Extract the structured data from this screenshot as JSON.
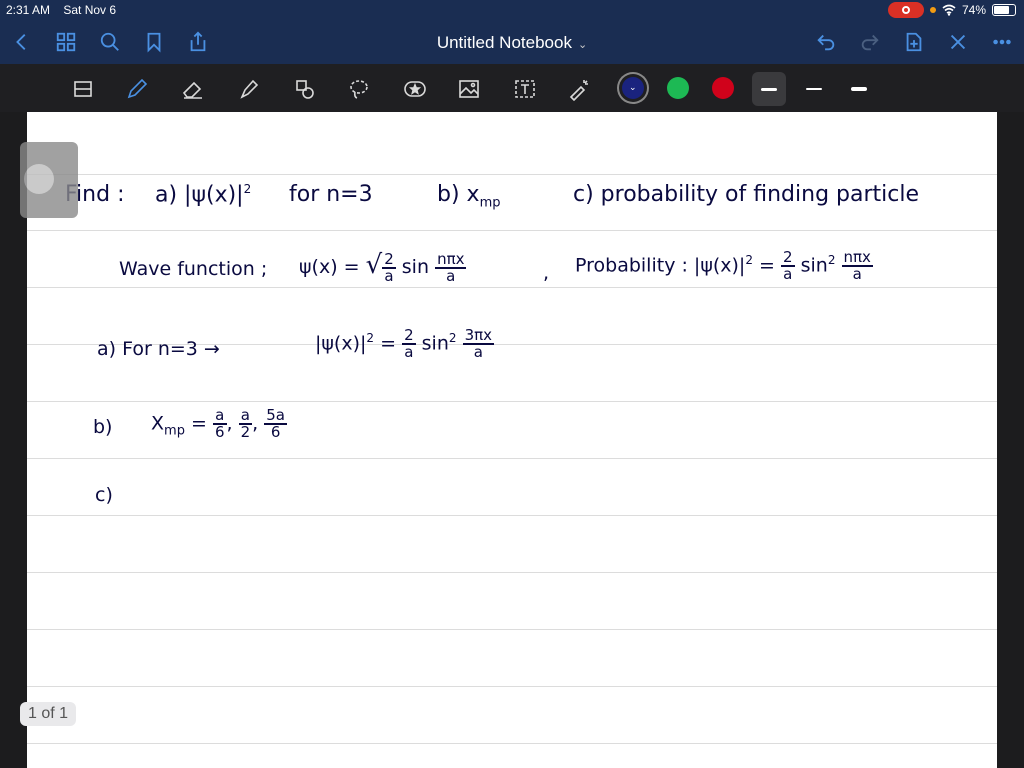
{
  "status": {
    "time": "2:31 AM",
    "date": "Sat Nov 6",
    "battery": "74%",
    "battery_level": 0.74
  },
  "nav": {
    "title": "Untitled Notebook"
  },
  "toolbar": {
    "colors": [
      "#1a237e",
      "#1db954",
      "#d0021b"
    ],
    "tools": [
      "scan-icon",
      "pen-icon",
      "eraser-icon",
      "highlighter-icon",
      "shapes-icon",
      "lasso-icon",
      "star-icon",
      "image-icon",
      "text-icon",
      "laser-icon"
    ]
  },
  "notes": {
    "line1": {
      "find": "Find :",
      "a": "a) |ψ(x)|",
      "a_sup": "2",
      "a_cond": "for n=3",
      "b": "b) x",
      "b_sub": "mp",
      "c": "c) probability of finding particle"
    },
    "line2": {
      "wf": "Wave function ;",
      "psi": "ψ(x) =",
      "root": "√",
      "frac1_num": "2",
      "frac1_den": "a",
      "sin": "sin",
      "frac2_num": "nπx",
      "frac2_den": "a",
      "comma": ",",
      "prob": "Probability : |ψ(x)|",
      "prob_sup": "2",
      "eq": "=",
      "frac3_num": "2",
      "frac3_den": "a",
      "sin2": "sin",
      "sin2_sup": "2",
      "frac4_num": "nπx",
      "frac4_den": "a"
    },
    "line3": {
      "label": "a) For n=3 →",
      "expr": "|ψ(x)|",
      "expr_sup": "2",
      "eq": "=",
      "frac1_num": "2",
      "frac1_den": "a",
      "sin": "sin",
      "sin_sup": "2",
      "frac2_num": "3πx",
      "frac2_den": "a"
    },
    "line4": {
      "label": "b)",
      "x": "X",
      "x_sub": "mp",
      "eq": "=",
      "f1_num": "a",
      "f1_den": "6",
      "sep1": ",",
      "f2_num": "a",
      "f2_den": "2",
      "sep2": ",",
      "f3_num": "5a",
      "f3_den": "6"
    },
    "line5": {
      "label": "c)"
    }
  },
  "page_indicator": "1 of 1"
}
